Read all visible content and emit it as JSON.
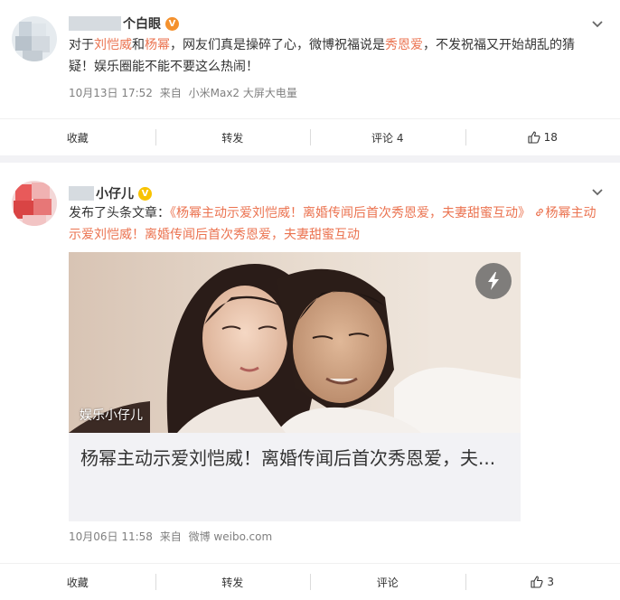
{
  "colors": {
    "link": "#eb7350",
    "badge_orange": "#f4912e",
    "badge_yellow": "#f8c300",
    "meta": "#808080"
  },
  "post1": {
    "author_name": "个白眼",
    "badge_icon": "verified-orange-icon",
    "text_parts": {
      "p1": "对于",
      "liu": "刘恺威",
      "and": "和",
      "yang": "杨幂",
      "p2": "，网友们真是操碎了心，微博祝福说是",
      "show": "秀恩爱",
      "p3": "，不发祝福又开始胡乱的猜疑！娱乐圈能不能不要这么热闹！"
    },
    "date": "10月13日 17:52",
    "source_label": "来自",
    "source": "小米Max2 大屏大电量",
    "actions": {
      "collect": "收藏",
      "forward": "转发",
      "comment": "评论 4",
      "like_count": "18"
    }
  },
  "post2": {
    "author_name": "小仔儿",
    "badge_icon": "verified-yellow-icon",
    "text_parts": {
      "prefix": "发布了头条文章：",
      "quote_open": "《",
      "t1": "杨幂主动示爱",
      "t2": "刘恺威",
      "t3": "！离婚传闻后首次",
      "t4": "秀恩爱",
      "t5": "，夫妻甜蜜互动",
      "quote_close": "》",
      "link_icon": "link-icon",
      "link_text": "杨幂主动示爱刘恺威！离婚传闻后首次秀恩爱，夫妻甜蜜互动"
    },
    "media": {
      "watermark": "娱乐小仔儿",
      "title": "杨幂主动示爱刘恺威！离婚传闻后首次秀恩爱，夫..."
    },
    "date": "10月06日 11:58",
    "source_label": "来自",
    "source": "微博 weibo.com",
    "actions": {
      "collect": "收藏",
      "forward": "转发",
      "comment": "评论",
      "like_count": "3"
    }
  }
}
